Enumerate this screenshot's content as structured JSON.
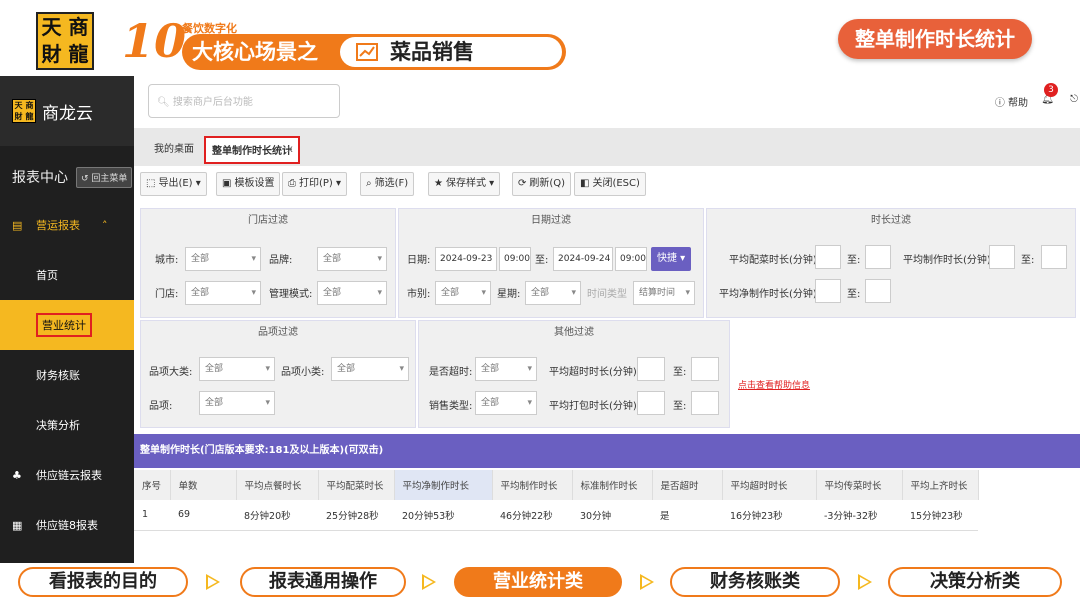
{
  "banner": {
    "logo_chars": [
      "天",
      "商",
      "財",
      "龍"
    ],
    "ten": "10",
    "subtitle": "餐饮数字化",
    "main_text": "大核心场景之",
    "pill_text": "菜品销售",
    "right_title": "整单制作时长统计"
  },
  "sidebar": {
    "brand": "商龙云",
    "logo_chars": [
      "天",
      "商",
      "財",
      "龍"
    ],
    "section": "报表中心",
    "back_button": "回主菜单",
    "items": [
      {
        "label": "营运报表",
        "type": "group"
      },
      {
        "label": "首页",
        "type": "sub"
      },
      {
        "label": "营业统计",
        "type": "sub-active"
      },
      {
        "label": "财务核账",
        "type": "sub"
      },
      {
        "label": "决策分析",
        "type": "sub"
      },
      {
        "label": "供应链云报表",
        "type": "item"
      },
      {
        "label": "供应链8报表",
        "type": "item"
      }
    ]
  },
  "header": {
    "search_placeholder": "搜索商户后台功能",
    "help": "帮助",
    "notification_count": "3"
  },
  "tabs": [
    {
      "label": "我的桌面"
    },
    {
      "label": "整单制作时长统计"
    }
  ],
  "tab_close": "x",
  "toolbar": {
    "export": "导出(E)",
    "template": "模板设置",
    "print": "打印(P)",
    "filter": "筛选(F)",
    "save_style": "保存样式",
    "refresh": "刷新(Q)",
    "close": "关闭(ESC)"
  },
  "filters": {
    "store": {
      "title": "门店过滤",
      "city_label": "城市:",
      "city_value": "全部",
      "brand_label": "品牌:",
      "brand_value": "全部",
      "store_label": "门店:",
      "store_value": "全部",
      "mgmt_label": "管理模式:",
      "mgmt_value": "全部"
    },
    "date": {
      "title": "日期过滤",
      "date_label": "日期:",
      "start_date": "2024-09-23",
      "start_time": "09:00",
      "to": "至:",
      "end_date": "2024-09-24",
      "end_time": "09:00",
      "quick": "快捷",
      "market_label": "市别:",
      "market_value": "全部",
      "week_label": "星期:",
      "week_value": "全部",
      "time_type_label": "时间类型",
      "time_type_value": "结算时间"
    },
    "duration": {
      "title": "时长过滤",
      "avg_dish_label": "平均配菜时长(分钟):",
      "avg_make_label": "平均制作时长(分钟):",
      "avg_net_label": "平均净制作时长(分钟):",
      "to": "至:"
    },
    "item": {
      "title": "品项过滤",
      "big_label": "品项大类:",
      "big_value": "全部",
      "small_label": "品项小类:",
      "small_value": "全部",
      "item_label": "品项:",
      "item_value": "全部"
    },
    "other": {
      "title": "其他过滤",
      "overtime_label": "是否超时:",
      "overtime_value": "全部",
      "sales_label": "销售类型:",
      "sales_value": "全部",
      "avg_over_label": "平均超时时长(分钟):",
      "avg_pack_label": "平均打包时长(分钟):",
      "to": "至:"
    },
    "help_link": "点击查看帮助信息"
  },
  "report": {
    "header": "整单制作时长(门店版本要求:181及以上版本)(可双击)",
    "columns": [
      "序号",
      "单数",
      "平均点餐时长",
      "平均配菜时长",
      "平均净制作时长",
      "平均制作时长",
      "标准制作时长",
      "是否超时",
      "平均超时时长",
      "平均传菜时长",
      "平均上齐时长"
    ],
    "rows": [
      [
        "1",
        "69",
        "8分钟20秒",
        "25分钟28秒",
        "20分钟53秒",
        "46分钟22秒",
        "30分钟",
        "是",
        "16分钟23秒",
        "-3分钟-32秒",
        "15分钟23秒"
      ]
    ]
  },
  "bottom_steps": [
    {
      "label": "看报表的目的",
      "active": false
    },
    {
      "label": "报表通用操作",
      "active": false
    },
    {
      "label": "营业统计类",
      "active": true
    },
    {
      "label": "财务核账类",
      "active": false
    },
    {
      "label": "决策分析类",
      "active": false
    }
  ],
  "colors": {
    "accent": "#f07a1a",
    "brand_yellow": "#f5b820",
    "purple": "#6a5fc1",
    "highlight_red": "#e02020"
  }
}
